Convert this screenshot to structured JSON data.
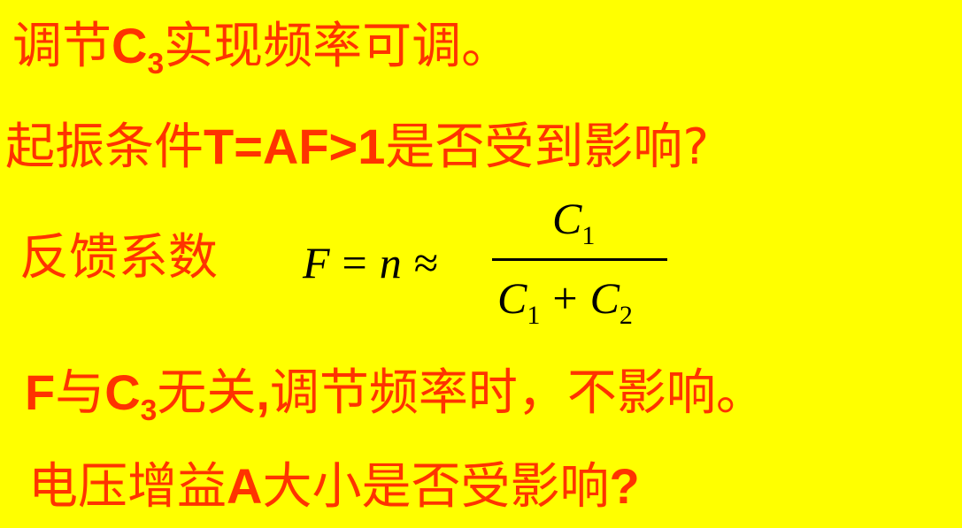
{
  "slide": {
    "background_color": "#ffff00",
    "text_color": "#ff3300",
    "line1": {
      "a": "调节",
      "b": "C",
      "b_sub": "3",
      "c": "实现频率可调。"
    },
    "line2": {
      "a": "起振条件",
      "b": "T=AF>1",
      "c": "是否受到影响?"
    },
    "line3": {
      "label": "反馈系数"
    },
    "formula": {
      "lhs_F": "F",
      "eq": "=",
      "lhs_n": "n",
      "approx": "≈",
      "num_C": "C",
      "num_sub": "1",
      "den_C1": "C",
      "den_sub1": "1",
      "plus": "+",
      "den_C2": "C",
      "den_sub2": "2"
    },
    "line4": {
      "a": "F",
      "b": "与",
      "c": "C",
      "c_sub": "3",
      "d": "无关",
      "e": ",",
      "f": "调节频率时，不影响。"
    },
    "line5": {
      "a": "电压增益",
      "b": "A",
      "c": "大小是否受影响",
      "d": "?"
    }
  }
}
